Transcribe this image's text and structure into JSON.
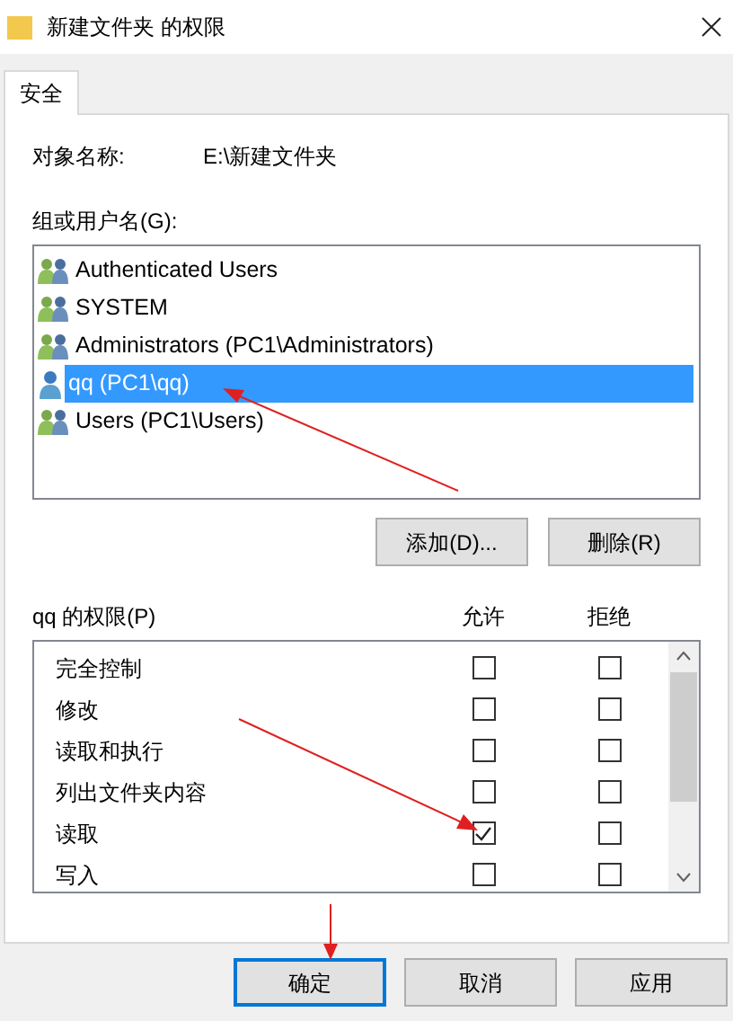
{
  "window": {
    "title": "新建文件夹 的权限"
  },
  "tabs": [
    {
      "label": "安全",
      "selected": true
    }
  ],
  "object": {
    "label": "对象名称:",
    "value": "E:\\新建文件夹"
  },
  "users_label": "组或用户名(G):",
  "users": [
    {
      "name": "Authenticated Users",
      "kind": "group",
      "selected": false
    },
    {
      "name": "SYSTEM",
      "kind": "group",
      "selected": false
    },
    {
      "name": "Administrators (PC1\\Administrators)",
      "kind": "group",
      "selected": false
    },
    {
      "name": "qq (PC1\\qq)",
      "kind": "user",
      "selected": true
    },
    {
      "name": "Users (PC1\\Users)",
      "kind": "group",
      "selected": false
    }
  ],
  "user_buttons": [
    "添加(D)...",
    "删除(R)"
  ],
  "permissions_label": "qq 的权限(P)",
  "columns": [
    "允许",
    "拒绝"
  ],
  "permissions": [
    {
      "name": "完全控制",
      "allow": false,
      "deny": false
    },
    {
      "name": "修改",
      "allow": false,
      "deny": false
    },
    {
      "name": "读取和执行",
      "allow": false,
      "deny": false
    },
    {
      "name": "列出文件夹内容",
      "allow": false,
      "deny": false
    },
    {
      "name": "读取",
      "allow": true,
      "deny": false
    },
    {
      "name": "写入",
      "allow": false,
      "deny": false
    }
  ],
  "buttons": [
    {
      "label": "确定",
      "default": true
    },
    {
      "label": "取消",
      "default": false
    },
    {
      "label": "应用",
      "default": false
    }
  ]
}
